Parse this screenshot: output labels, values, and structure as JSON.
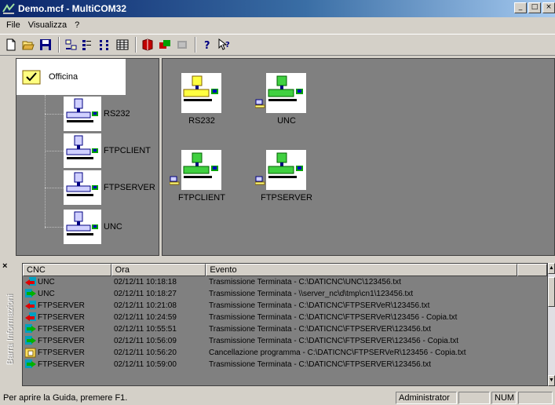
{
  "window": {
    "title": "Demo.mcf - MultiCOM32",
    "minimize": "_",
    "maximize": "□",
    "close": "×"
  },
  "menu": [
    "File",
    "Visualizza",
    "?"
  ],
  "toolbar": {
    "items": [
      "new-icon",
      "open-icon",
      "save-icon",
      "large-icons-icon",
      "small-icons-icon",
      "list-icon",
      "details-icon",
      "book-icon",
      "transfer-icon",
      "disabled-icon",
      "help-icon",
      "context-help-icon"
    ]
  },
  "tree": {
    "root": "Officina",
    "children": [
      "RS232",
      "FTPCLIENT",
      "FTPSERVER",
      "UNC"
    ]
  },
  "machines": [
    {
      "label": "RS232",
      "status": "yellow"
    },
    {
      "label": "UNC",
      "status": "green"
    },
    {
      "label": "FTPCLIENT",
      "status": "green"
    },
    {
      "label": "FTPSERVER",
      "status": "green"
    }
  ],
  "info_panel": {
    "close": "×",
    "sidebar_label": "Barra Informazioni",
    "columns": [
      "CNC",
      "Ora",
      "Evento"
    ],
    "rows": [
      {
        "cnc": "UNC",
        "ora": "02/12/11 10:18:18",
        "evento": "Trasmissione Terminata - C:\\DATICNC\\UNC\\123456.txt",
        "icon": "receive-icon"
      },
      {
        "cnc": "UNC",
        "ora": "02/12/11 10:18:27",
        "evento": "Trasmissione Terminata - \\\\server_nc\\d\\tmp\\cn1\\123456.txt",
        "icon": "send-icon"
      },
      {
        "cnc": "FTPSERVER",
        "ora": "02/12/11 10:21:08",
        "evento": "Trasmissione Terminata - C:\\DATICNC\\FTPSERVeR\\123456.txt",
        "icon": "receive-icon"
      },
      {
        "cnc": "FTPSERVER",
        "ora": "02/12/11 10:24:59",
        "evento": "Trasmissione Terminata - C:\\DATICNC\\FTPSERVeR\\123456 - Copia.txt",
        "icon": "receive-icon"
      },
      {
        "cnc": "FTPSERVER",
        "ora": "02/12/11 10:55:51",
        "evento": "Trasmissione Terminata - C:\\DATICNC\\FTPSERVER\\123456.txt",
        "icon": "send-icon"
      },
      {
        "cnc": "FTPSERVER",
        "ora": "02/12/11 10:56:09",
        "evento": "Trasmissione Terminata - C:\\DATICNC\\FTPSERVER\\123456 - Copia.txt",
        "icon": "send-icon"
      },
      {
        "cnc": "FTPSERVER",
        "ora": "02/12/11 10:56:20",
        "evento": "Cancellazione programma  - C:\\DATICNC\\FTPSERVeR\\123456 - Copia.txt",
        "icon": "delete-icon"
      },
      {
        "cnc": "FTPSERVER",
        "ora": "02/12/11 10:59:00",
        "evento": "Trasmissione Terminata - C:\\DATICNC\\FTPSERVER\\123456.txt",
        "icon": "send-icon"
      }
    ]
  },
  "statusbar": {
    "text": "Per aprire la Guida, premere F1.",
    "user": "Administrator",
    "num": "NUM"
  }
}
